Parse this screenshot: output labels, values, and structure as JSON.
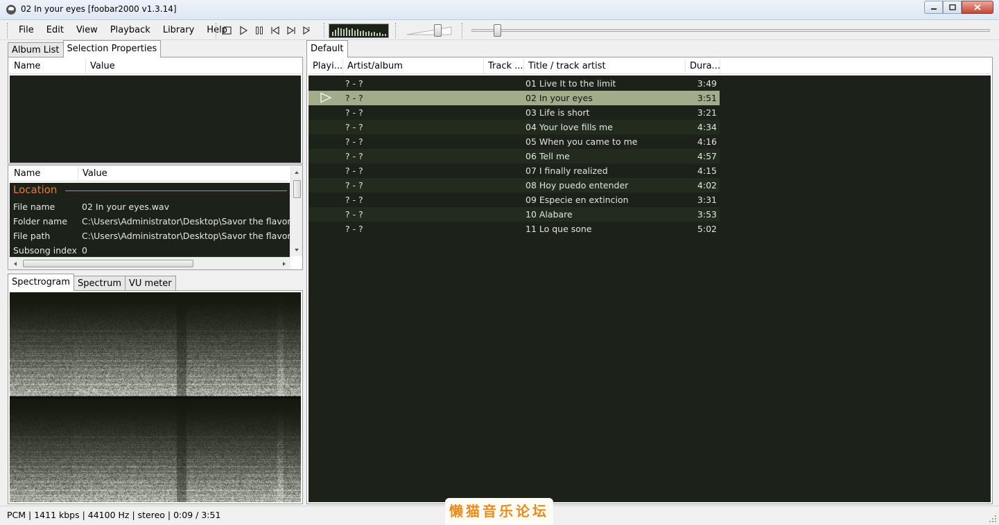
{
  "window": {
    "title": "02 In your eyes   [foobar2000 v1.3.14]"
  },
  "menu": [
    "File",
    "Edit",
    "View",
    "Playback",
    "Library",
    "Help"
  ],
  "volume_level": 0.7,
  "seek_progress": 0.043,
  "left_tabs": [
    "Album List",
    "Selection Properties"
  ],
  "upper_props": {
    "col_name": "Name",
    "col_value": "Value"
  },
  "properties": {
    "col_name": "Name",
    "col_value": "Value",
    "section": "Location",
    "rows": [
      {
        "k": "File name",
        "v": "02 In your eyes.wav"
      },
      {
        "k": "Folder name",
        "v": "C:\\Users\\Administrator\\Desktop\\Savor the flavor wi"
      },
      {
        "k": "File path",
        "v": "C:\\Users\\Administrator\\Desktop\\Savor the flavor wi"
      },
      {
        "k": "Subsong index",
        "v": "0"
      }
    ]
  },
  "vis_tabs": [
    "Spectrogram",
    "Spectrum",
    "VU meter"
  ],
  "playlist_tab": "Default",
  "playlist": {
    "columns": [
      "Playi...",
      "Artist/album",
      "Track ...",
      "Title / track artist",
      "Dura..."
    ],
    "rows": [
      {
        "artist": "? - ?",
        "title": "01 Live It to the limit",
        "duration": "3:49"
      },
      {
        "artist": "? - ?",
        "title": "02 In your eyes",
        "duration": "3:51",
        "playing": true
      },
      {
        "artist": "? - ?",
        "title": "03 Life is short",
        "duration": "3:21"
      },
      {
        "artist": "? - ?",
        "title": "04 Your love fills me",
        "duration": "4:34"
      },
      {
        "artist": "? - ?",
        "title": "05 When you came to me",
        "duration": "4:16"
      },
      {
        "artist": "? - ?",
        "title": "06 Tell me",
        "duration": "4:57"
      },
      {
        "artist": "? - ?",
        "title": "07 I finally realized",
        "duration": "4:15"
      },
      {
        "artist": "? - ?",
        "title": "08 Hoy puedo entender",
        "duration": "4:02"
      },
      {
        "artist": "? - ?",
        "title": "09 Especie en extincion",
        "duration": "3:31"
      },
      {
        "artist": "? - ?",
        "title": "10 Alabare",
        "duration": "3:53"
      },
      {
        "artist": "? - ?",
        "title": "11 Lo que sone",
        "duration": "5:02"
      }
    ]
  },
  "status": "PCM | 1411 kbps | 44100 Hz | stereo | 0:09 / 3:51",
  "watermark": "懒猫音乐论坛",
  "colors": {
    "dark_bg": "#1c2119",
    "selected_row": "#a3ac8a",
    "accent": "#e97938"
  }
}
